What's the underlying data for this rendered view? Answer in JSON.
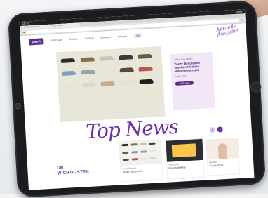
{
  "statusbar": {
    "time": "10:45",
    "battery": "100%"
  },
  "browser": {
    "tab1": "SNEAKER-Shop",
    "tab2": "Top News"
  },
  "site": {
    "logo": "SNKR",
    "nav": [
      "Top Deals",
      "Sneaker",
      "Fashion",
      "Releases",
      "Lifestyle"
    ],
    "nav_button": "Info",
    "script_badge": "Aktuelle Ausgabe"
  },
  "promo": {
    "kicker": "Adidas Yeezy Boost",
    "headline": "Yeezy Restocked erscheint Adidas Millionenumsatz",
    "meta": "Februar 2024",
    "button": "Jetzt lesen"
  },
  "section": {
    "title": "Top News",
    "die": "Die",
    "wichtigsten": "WICHTIGSTEN"
  },
  "cards": [
    {
      "caption": "Yeezy Release",
      "title": "Yeezy Restocked"
    },
    {
      "caption": "Workspace",
      "title": "Neue Kollektion"
    },
    {
      "caption": "Lifestyle",
      "title": "Trends 2024"
    }
  ],
  "colors": {
    "accent": "#6b2fb0",
    "hero_bg": "#e8e6d9",
    "shoes": [
      "#2b2b2b",
      "#8a6d4e",
      "#c9c3b8",
      "#3a3a3a",
      "#6c5a47",
      "#7f9fbf",
      "#9aa3a8",
      "#e9e4dc",
      "#5a4a3c",
      "#b35e55",
      "#e7e2da",
      "#dcd7ce",
      "#caa98c",
      "#e4e0d8",
      "#1f1f1f"
    ]
  }
}
